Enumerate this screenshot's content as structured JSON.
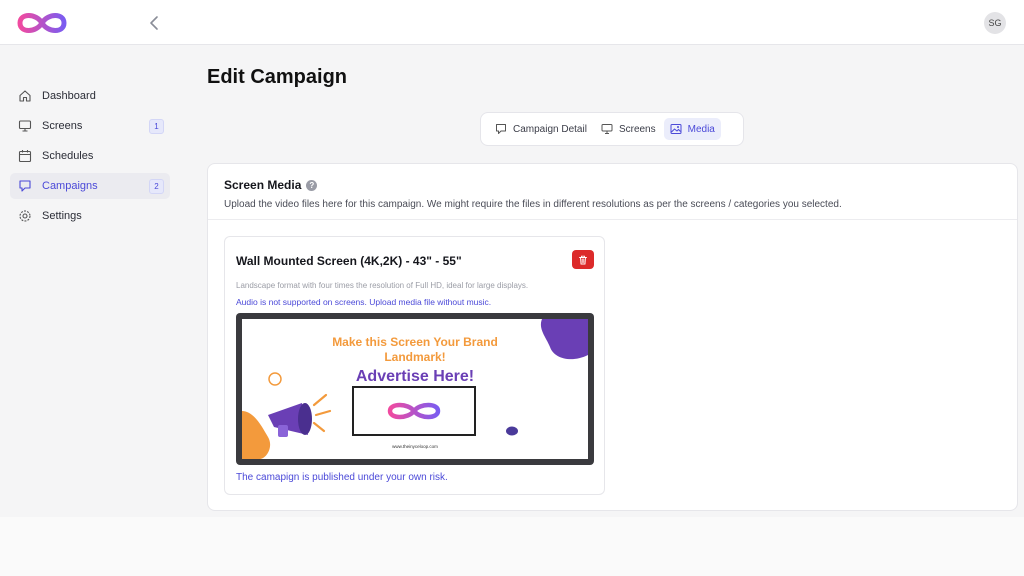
{
  "header": {
    "avatar_initials": "SG",
    "brand_gradient": [
      "#f04aa0",
      "#7b5cf0"
    ]
  },
  "sidebar": {
    "items": [
      {
        "label": "Dashboard",
        "icon": "home-icon",
        "badge": null
      },
      {
        "label": "Screens",
        "icon": "monitor-icon",
        "badge": "1"
      },
      {
        "label": "Schedules",
        "icon": "calendar-icon",
        "badge": null
      },
      {
        "label": "Campaigns",
        "icon": "campaign-icon",
        "badge": "2",
        "active": true
      },
      {
        "label": "Settings",
        "icon": "gear-icon",
        "badge": null
      }
    ]
  },
  "page": {
    "title": "Edit Campaign"
  },
  "tabs": [
    {
      "label": "Campaign Detail",
      "icon": "campaign-icon"
    },
    {
      "label": "Screens",
      "icon": "monitor-icon"
    },
    {
      "label": "Media",
      "icon": "image-icon",
      "active": true
    }
  ],
  "screen_media": {
    "title": "Screen Media",
    "help_symbol": "?",
    "description": "Upload the video files here for this campaign. We might require the files in different resolutions as per the screens / categories you selected.",
    "item": {
      "title": "Wall Mounted Screen (4K,2K) - 43\" - 55\"",
      "note": "Landscape format with four times the resolution of Full HD, ideal for large displays.",
      "warning": "Audio is not supported on screens. Upload media file without music.",
      "preview": {
        "headline_line1": "Make this Screen Your Brand",
        "headline_line2": "Landmark!",
        "cta": "Advertise Here!",
        "url": "www.theinyceloop.com"
      },
      "disclaimer": "The camapign is published under your own risk."
    }
  },
  "colors": {
    "accent": "#4b49d8",
    "danger": "#dc2a2a",
    "orange": "#f39a3c",
    "purple": "#6a3fb5"
  }
}
